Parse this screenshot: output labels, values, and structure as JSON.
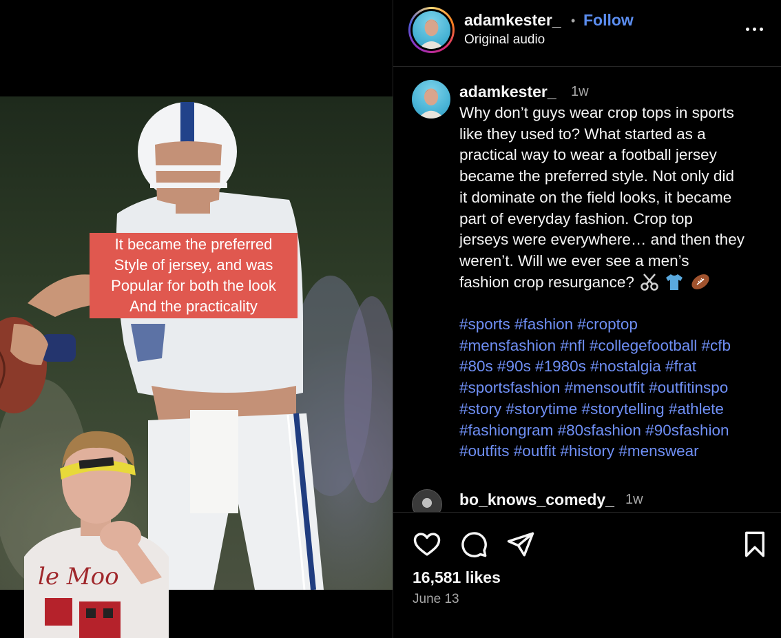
{
  "media": {
    "overlay_lines": [
      "It became the preferred",
      "Style of jersey, and was",
      "Popular for both the look",
      "And the practicality"
    ]
  },
  "header": {
    "username": "adamkester_",
    "separator": "•",
    "follow_label": "Follow",
    "audio_label": "Original audio",
    "more_icon": "more-horizontal-icon"
  },
  "caption": {
    "username": "adamkester_",
    "time": "1w",
    "lines": [
      "Why don’t guys wear crop tops in sports",
      "like they used to? What started as a",
      "practical way to wear a football jersey",
      "became the preferred style. Not only did",
      "it dominate on the field looks, it became",
      "part of everyday fashion. Crop top",
      "jerseys were everywhere… and then they",
      "weren’t. Will we ever see a men’s",
      "fashion crop resurgance?"
    ],
    "emojis": [
      "scissors-icon",
      "tshirt-icon",
      "football-icon"
    ],
    "hashtag_lines": [
      "#sports #fashion #croptop",
      "#mensfashion #nfl #collegefootball #cfb",
      "#80s #90s #1980s #nostalgia #frat",
      "#sportsfashion #mensoutfit #outfitinspo",
      "#story #storytime #storytelling #athlete",
      "#fashiongram #80sfashion #90sfashion",
      "#outfits #outfit #history #menswear"
    ]
  },
  "comment": {
    "username": "bo_knows_comedy_",
    "time": "1w"
  },
  "actions": {
    "icons": [
      "heart-icon",
      "comment-icon",
      "share-icon",
      "bookmark-icon"
    ],
    "likes": "16,581 likes",
    "date": "June 13"
  },
  "colors": {
    "background": "#000000",
    "link_blue": "#5b8def",
    "hashtag_blue": "#6f8ff5",
    "overlay_red": "#e0584f",
    "muted_text": "#a8a8a8"
  }
}
